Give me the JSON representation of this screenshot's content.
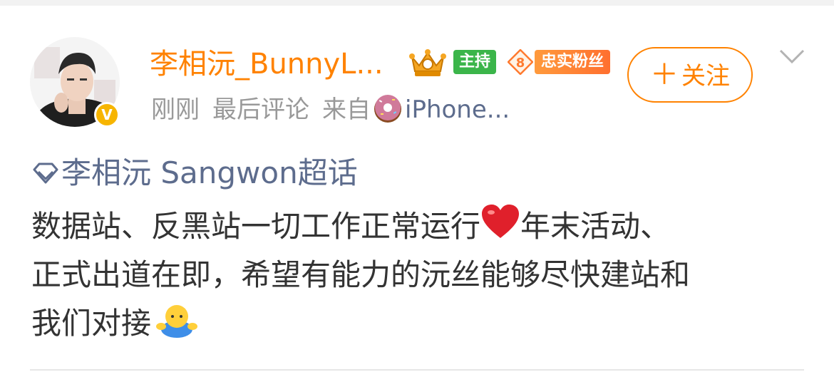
{
  "post": {
    "user": {
      "name": "李相沅_BunnyL...",
      "verified_badge": "V",
      "badges": {
        "host": "主持",
        "fan_level": "8",
        "fan_label": "忠实粉丝"
      }
    },
    "follow_button": {
      "plus": "＋",
      "label": "关注"
    },
    "meta": {
      "time": "刚刚",
      "activity": "最后评论",
      "from_label": "来自",
      "device": "iPhone..."
    },
    "topic": "李相沅 Sangwon超话",
    "content": {
      "line1_a": "数据站、反黑站一切工作正常运行",
      "line1_b": "年末活动、",
      "line2": "正式出道在即，希望有能力的沅丝能够尽快建站和",
      "line3": "我们对接"
    },
    "icons": {
      "crown": "crown-icon",
      "donut": "donut-icon",
      "heart": "heart-emoji",
      "hug": "hug-emoji",
      "chevron": "chevron-down-icon",
      "topic": "diamond-icon"
    },
    "colors": {
      "username": "#ff8200",
      "link": "#5d6c8d",
      "meta": "#999999",
      "host_badge": "#3bb54a",
      "verified": "#f7b500"
    }
  }
}
